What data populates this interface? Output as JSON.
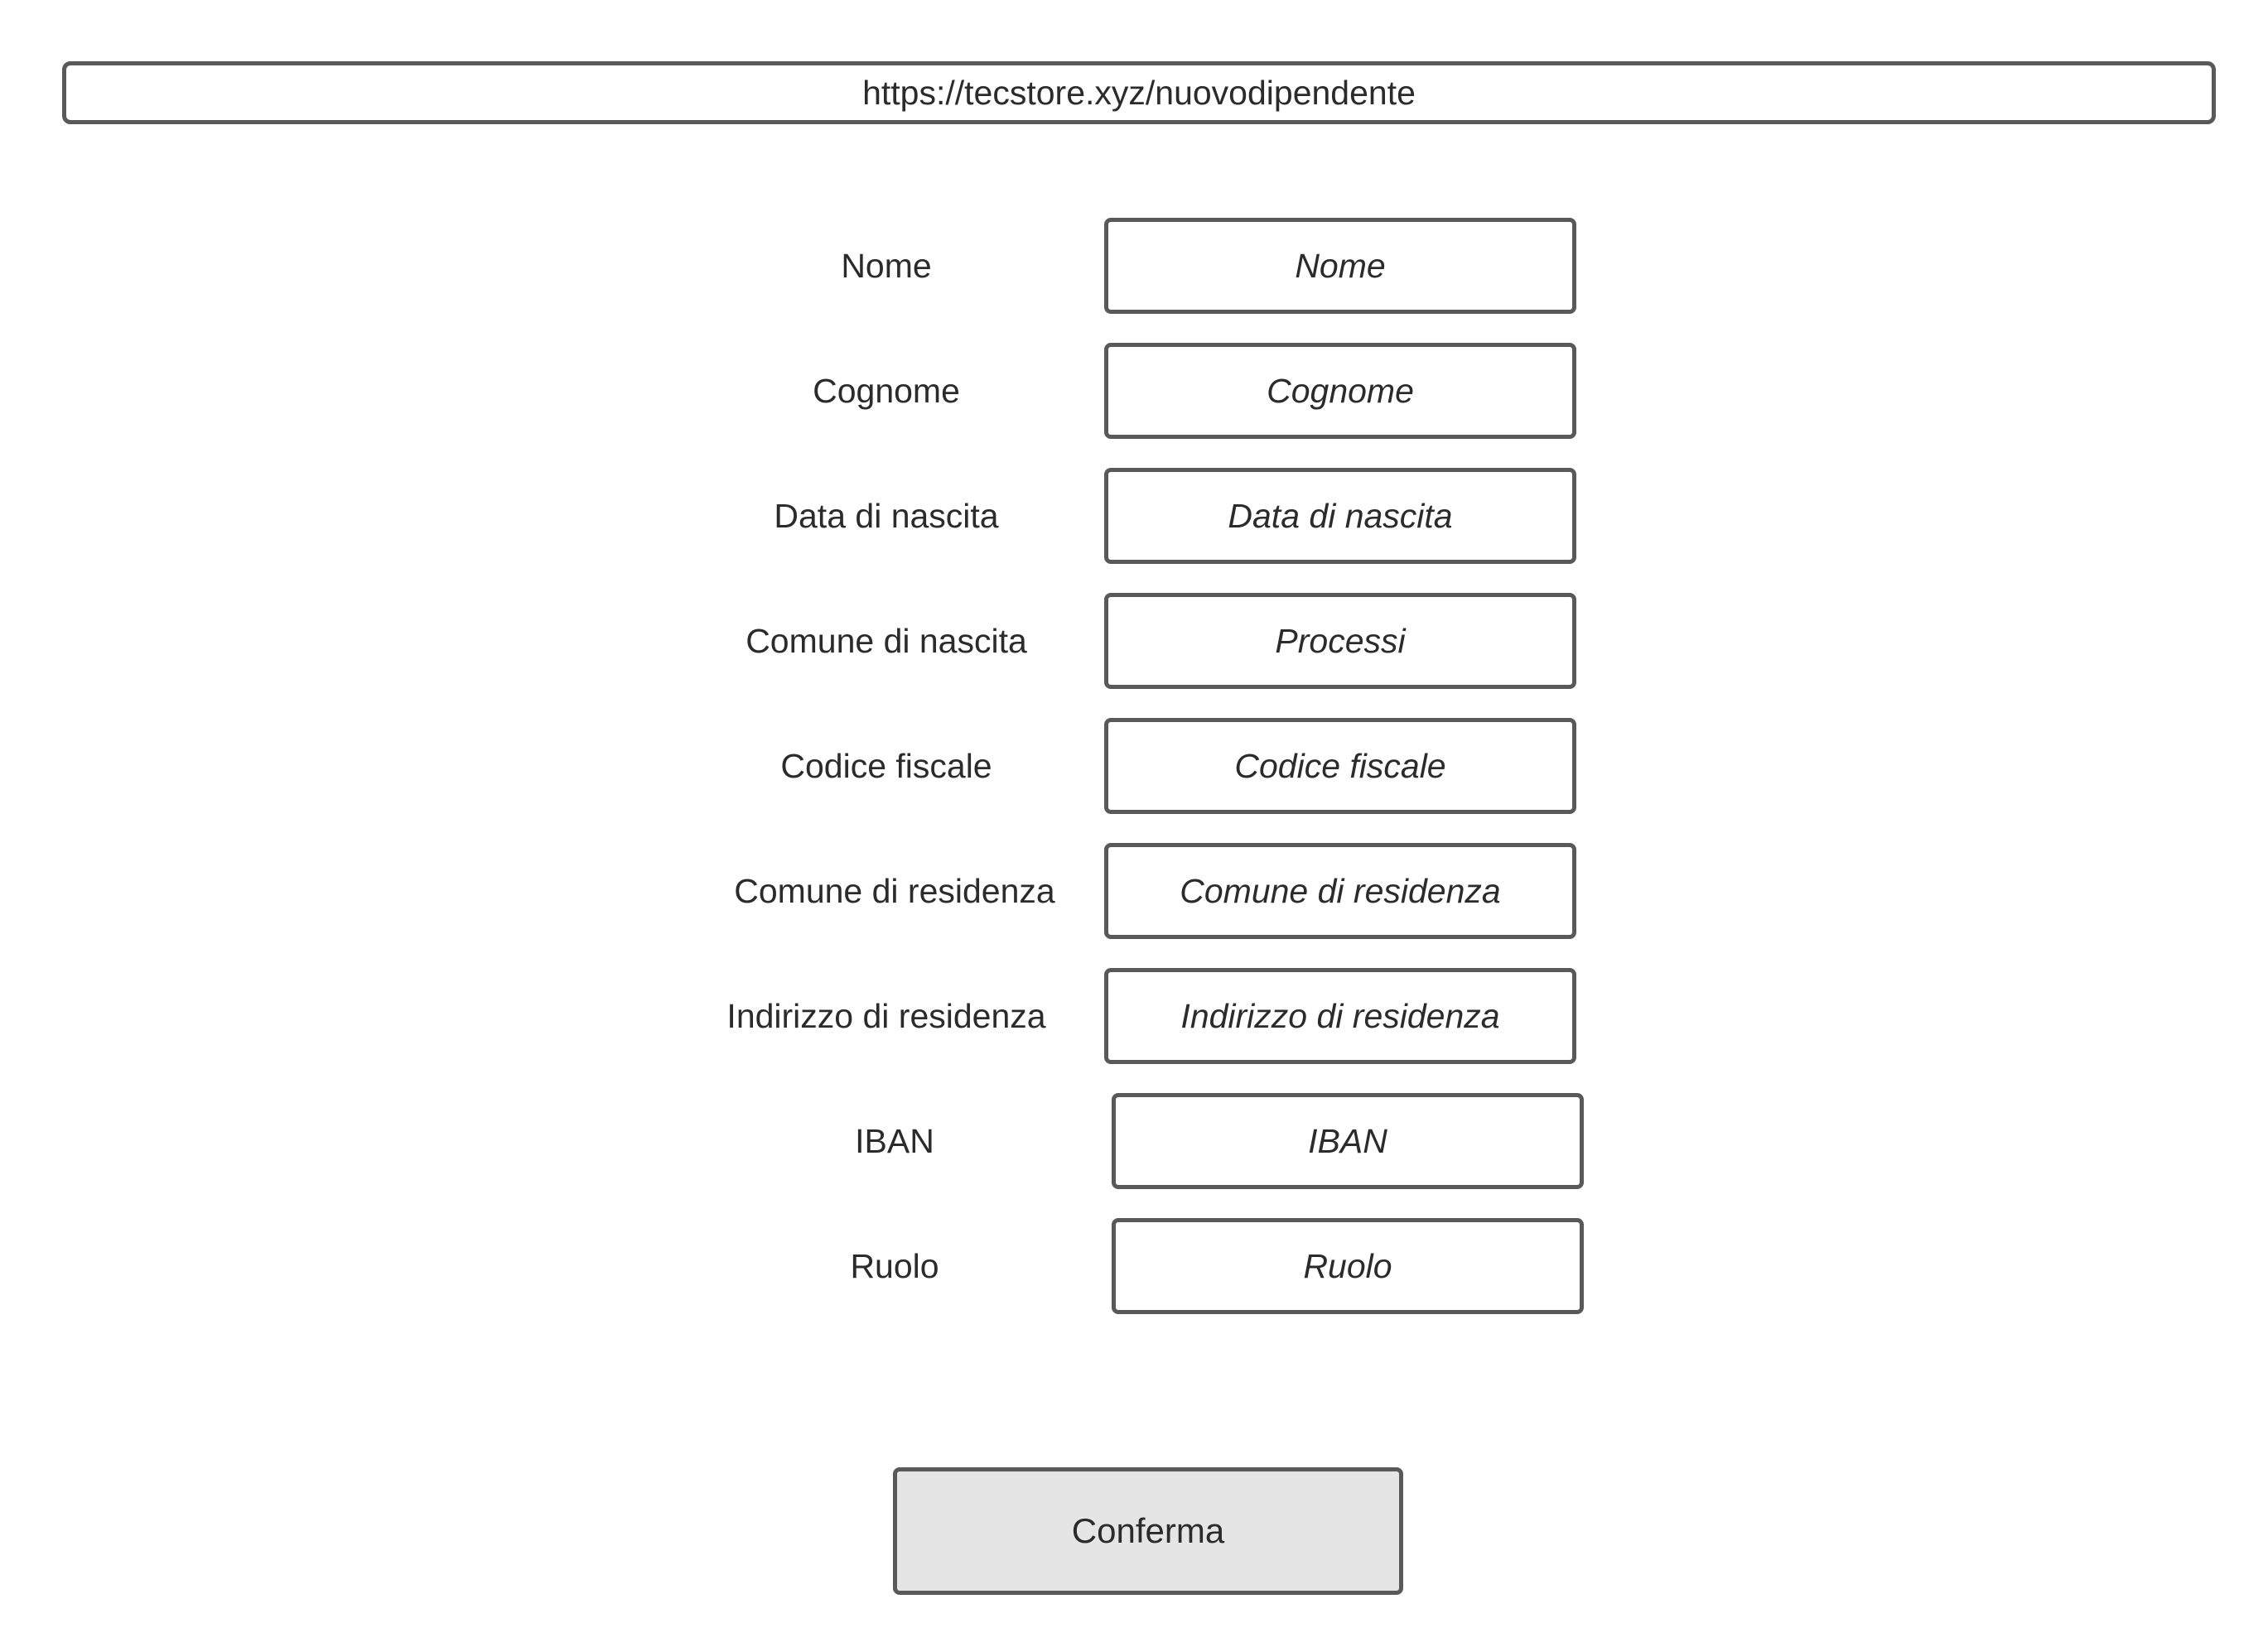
{
  "address_bar": {
    "url": "https://tecstore.xyz/nuovodipendente"
  },
  "form": {
    "fields": [
      {
        "label": "Nome",
        "placeholder": "Nome"
      },
      {
        "label": "Cognome",
        "placeholder": "Cognome"
      },
      {
        "label": "Data di nascita",
        "placeholder": "Data di nascita"
      },
      {
        "label": "Comune di nascita",
        "placeholder": "Processi"
      },
      {
        "label": "Codice fiscale",
        "placeholder": "Codice fiscale"
      },
      {
        "label": "Comune di residenza",
        "placeholder": "Comune di residenza"
      },
      {
        "label": "Indirizzo di residenza",
        "placeholder": "Indirizzo di residenza"
      },
      {
        "label": "IBAN",
        "placeholder": "IBAN"
      },
      {
        "label": "Ruolo",
        "placeholder": "Ruolo"
      }
    ],
    "submit_label": "Conferma"
  }
}
